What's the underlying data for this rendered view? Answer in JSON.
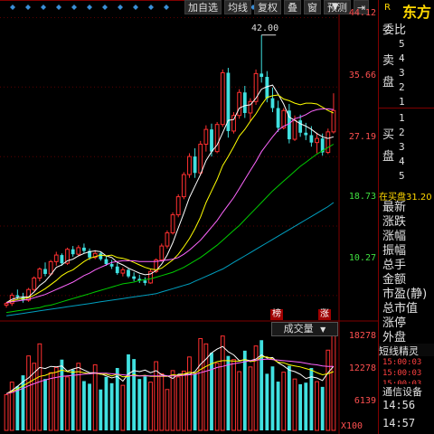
{
  "toolbar": {
    "buttons": [
      "加自选",
      "均线",
      "复权",
      "叠",
      "窗",
      "预测"
    ],
    "icon_dock": "pin-icon",
    "icon_menu": "triangle-down-icon"
  },
  "price_axis": [
    "44.12",
    "35.66",
    "27.19",
    "18.73",
    "10.27"
  ],
  "price_axis_values": [
    44.12,
    35.66,
    27.19,
    18.73,
    10.27
  ],
  "volume_axis": [
    "18278",
    "12278",
    "6139"
  ],
  "volume_unit": "X100",
  "high_marker": "42.00",
  "volume_panel": {
    "title": "成交量"
  },
  "badges": [
    "榜",
    "涨"
  ],
  "right_panel": {
    "stock_name": "东方",
    "r_label": "R",
    "weibi": "委比",
    "sell_label": "卖\n盘",
    "sell_levels": [
      "5",
      "4",
      "3",
      "2",
      "1"
    ],
    "buy_levels": [
      "1",
      "2",
      "3",
      "4",
      "5"
    ],
    "buy_label": "买\n盘",
    "buy_vol_text": "在买盘31.20",
    "fields": [
      "最新",
      "涨跌",
      "涨幅",
      "振幅",
      "总手",
      "金额",
      "市盈(静)",
      "总市值",
      "涨停",
      "外盘"
    ],
    "sl_title": "短线精灵",
    "sl_times": [
      "15:00:03",
      "15:00:03",
      "15:00:03"
    ],
    "comm": "通信设备",
    "clocks": [
      "14:56",
      "14:57"
    ]
  },
  "colors": {
    "up": "#ff3030",
    "down": "#40e0e0",
    "ma5": "#ffffff",
    "ma10": "#ffff00",
    "ma20": "#ff66ff",
    "ma60": "#00cc00",
    "ma120": "#00a0c0",
    "axis_red": "#800000"
  },
  "chart_data": {
    "type": "candlestick",
    "ylim": [
      7.5,
      44.5
    ],
    "candles": [
      [
        9.1,
        9.5,
        8.8,
        9.3
      ],
      [
        9.3,
        10.6,
        9.0,
        10.3
      ],
      [
        10.3,
        11.0,
        9.8,
        10.1
      ],
      [
        10.1,
        10.6,
        9.4,
        9.7
      ],
      [
        9.7,
        11.2,
        9.5,
        11.0
      ],
      [
        11.0,
        12.6,
        10.8,
        12.4
      ],
      [
        12.4,
        13.7,
        12.0,
        13.5
      ],
      [
        13.5,
        14.3,
        12.6,
        12.9
      ],
      [
        12.9,
        14.6,
        12.7,
        14.4
      ],
      [
        14.4,
        15.6,
        13.9,
        15.2
      ],
      [
        15.2,
        15.4,
        13.9,
        14.2
      ],
      [
        14.2,
        16.1,
        14.0,
        15.9
      ],
      [
        15.9,
        16.3,
        15.0,
        15.3
      ],
      [
        15.3,
        16.4,
        15.1,
        16.1
      ],
      [
        16.1,
        16.6,
        15.4,
        15.7
      ],
      [
        15.7,
        16.0,
        14.6,
        14.9
      ],
      [
        14.9,
        15.8,
        14.7,
        15.4
      ],
      [
        15.4,
        15.6,
        14.5,
        14.7
      ],
      [
        14.7,
        15.1,
        13.9,
        14.1
      ],
      [
        14.1,
        14.6,
        13.5,
        13.8
      ],
      [
        13.8,
        14.2,
        12.8,
        13.0
      ],
      [
        13.0,
        13.7,
        12.6,
        13.4
      ],
      [
        13.4,
        13.6,
        12.4,
        12.6
      ],
      [
        12.6,
        13.1,
        12.0,
        12.3
      ],
      [
        12.3,
        12.8,
        11.8,
        12.1
      ],
      [
        12.1,
        12.5,
        11.5,
        11.8
      ],
      [
        11.8,
        13.5,
        11.7,
        13.2
      ],
      [
        13.2,
        14.8,
        13.0,
        14.6
      ],
      [
        14.6,
        16.6,
        14.4,
        16.3
      ],
      [
        16.3,
        18.2,
        16.0,
        17.9
      ],
      [
        17.9,
        20.4,
        17.7,
        20.1
      ],
      [
        20.1,
        22.6,
        19.8,
        22.3
      ],
      [
        22.3,
        25.3,
        22.0,
        25.0
      ],
      [
        25.0,
        27.6,
        24.6,
        27.2
      ],
      [
        27.2,
        28.2,
        24.6,
        25.2
      ],
      [
        25.2,
        29.1,
        24.9,
        28.7
      ],
      [
        28.7,
        31.0,
        27.8,
        30.5
      ],
      [
        30.5,
        31.2,
        27.2,
        27.8
      ],
      [
        27.8,
        31.4,
        27.6,
        31.1
      ],
      [
        31.1,
        37.8,
        30.8,
        37.4
      ],
      [
        37.4,
        38.0,
        29.5,
        30.3
      ],
      [
        30.3,
        32.6,
        30.0,
        32.2
      ],
      [
        32.2,
        35.4,
        31.8,
        35.0
      ],
      [
        35.0,
        35.8,
        31.9,
        32.5
      ],
      [
        32.5,
        34.3,
        31.5,
        33.9
      ],
      [
        33.9,
        37.8,
        33.5,
        37.3
      ],
      [
        37.3,
        42.0,
        36.2,
        36.9
      ],
      [
        36.9,
        37.6,
        33.8,
        34.3
      ],
      [
        34.3,
        35.6,
        32.6,
        33.1
      ],
      [
        33.1,
        34.0,
        30.2,
        30.7
      ],
      [
        30.7,
        33.1,
        30.5,
        32.8
      ],
      [
        32.8,
        33.6,
        28.8,
        29.3
      ],
      [
        29.3,
        32.2,
        29.1,
        31.6
      ],
      [
        31.6,
        32.3,
        29.6,
        30.1
      ],
      [
        30.1,
        31.3,
        29.2,
        29.8
      ],
      [
        29.8,
        30.9,
        28.4,
        28.9
      ],
      [
        28.9,
        30.1,
        27.6,
        29.4
      ],
      [
        29.4,
        30.0,
        27.3,
        27.7
      ],
      [
        27.7,
        30.6,
        27.5,
        30.2
      ],
      [
        30.2,
        34.9,
        30.0,
        32.8
      ]
    ],
    "ma": {
      "ma5": [
        9.4,
        9.8,
        10.0,
        10.1,
        10.1,
        10.7,
        11.5,
        12.0,
        12.8,
        13.7,
        14.0,
        14.5,
        14.7,
        15.1,
        15.4,
        15.6,
        15.7,
        15.6,
        15.1,
        14.9,
        14.3,
        14.0,
        13.6,
        13.3,
        13.0,
        12.8,
        12.9,
        13.3,
        14.1,
        15.2,
        16.7,
        18.5,
        20.3,
        22.2,
        23.6,
        25.0,
        26.7,
        27.8,
        28.6,
        30.1,
        31.6,
        31.7,
        33.1,
        33.4,
        33.5,
        34.3,
        35.4,
        35.7,
        35.9,
        34.8,
        33.6,
        32.0,
        31.6,
        31.2,
        30.9,
        30.5,
        30.0,
        29.6,
        29.4,
        29.6
      ],
      "ma10": [
        9.4,
        9.6,
        9.8,
        9.9,
        10.0,
        10.3,
        10.7,
        11.1,
        11.6,
        12.1,
        12.7,
        13.1,
        13.4,
        13.9,
        14.4,
        14.8,
        15.0,
        15.2,
        15.1,
        15.2,
        14.9,
        14.8,
        14.6,
        14.3,
        14.0,
        13.7,
        13.5,
        13.4,
        13.6,
        14.1,
        14.6,
        15.3,
        16.2,
        17.2,
        18.4,
        19.8,
        21.6,
        23.0,
        24.4,
        26.1,
        27.2,
        28.4,
        29.7,
        30.5,
        31.5,
        32.4,
        33.5,
        34.4,
        34.6,
        34.7,
        34.2,
        34.0,
        33.7,
        33.5,
        33.7,
        33.7,
        33.6,
        33.2,
        32.8,
        32.5
      ],
      "ma20": [
        9.4,
        9.5,
        9.6,
        9.7,
        9.8,
        10.0,
        10.2,
        10.4,
        10.7,
        11.0,
        11.3,
        11.6,
        11.9,
        12.3,
        12.7,
        13.0,
        13.4,
        13.7,
        14.0,
        14.3,
        14.4,
        14.5,
        14.5,
        14.5,
        14.4,
        14.4,
        14.4,
        14.4,
        14.5,
        14.6,
        14.7,
        14.9,
        15.3,
        15.8,
        16.4,
        17.0,
        17.8,
        18.6,
        19.4,
        20.4,
        21.3,
        22.2,
        23.3,
        24.4,
        25.5,
        26.6,
        27.8,
        28.7,
        29.6,
        30.4,
        30.9,
        31.2,
        31.8,
        32.0,
        32.3,
        32.7,
        32.9,
        33.0,
        33.0,
        32.9
      ],
      "ma60": [
        8.2,
        8.3,
        8.4,
        8.5,
        8.6,
        8.7,
        8.8,
        9.0,
        9.1,
        9.3,
        9.5,
        9.7,
        9.9,
        10.1,
        10.3,
        10.5,
        10.7,
        10.9,
        11.1,
        11.3,
        11.5,
        11.7,
        11.8,
        11.9,
        12.1,
        12.2,
        12.3,
        12.5,
        12.7,
        12.9,
        13.1,
        13.4,
        13.7,
        14.1,
        14.5,
        14.9,
        15.4,
        15.9,
        16.4,
        17.0,
        17.6,
        18.2,
        18.8,
        19.5,
        20.2,
        20.9,
        21.6,
        22.3,
        23.0,
        23.6,
        24.2,
        24.8,
        25.4,
        26.0,
        26.5,
        27.0,
        27.5,
        27.9,
        28.3,
        28.7
      ],
      "ma120": [
        7.8,
        7.9,
        8.0,
        8.1,
        8.2,
        8.3,
        8.4,
        8.5,
        8.6,
        8.7,
        8.8,
        8.9,
        9.0,
        9.1,
        9.2,
        9.3,
        9.4,
        9.5,
        9.6,
        9.7,
        9.8,
        9.9,
        10.0,
        10.1,
        10.2,
        10.3,
        10.4,
        10.5,
        10.7,
        10.9,
        11.1,
        11.3,
        11.5,
        11.7,
        12.0,
        12.3,
        12.6,
        12.9,
        13.2,
        13.5,
        13.9,
        14.3,
        14.7,
        15.1,
        15.5,
        15.9,
        16.3,
        16.7,
        17.1,
        17.5,
        17.9,
        18.3,
        18.7,
        19.1,
        19.5,
        19.9,
        20.3,
        20.7,
        21.1,
        21.6
      ]
    },
    "volume": {
      "ylim": [
        0,
        18278
      ],
      "values": [
        6800,
        9200,
        8400,
        10500,
        14200,
        12800,
        16500,
        9800,
        11000,
        12000,
        13500,
        10200,
        11600,
        12800,
        9400,
        8900,
        12500,
        7800,
        10200,
        9000,
        11900,
        8600,
        14500,
        13600,
        9800,
        10300,
        9200,
        13100,
        10800,
        7800,
        11400,
        10200,
        11300,
        14000,
        10800,
        17500,
        16500,
        14800,
        12800,
        18000,
        14200,
        13500,
        11200,
        15200,
        12100,
        16100,
        17200,
        10800,
        12200,
        9300,
        11100,
        12300,
        9800,
        8800,
        9100,
        11900,
        9300,
        8300,
        15300,
        18200
      ],
      "ma5": [
        7000,
        7600,
        8400,
        9300,
        10000,
        11000,
        12000,
        11800,
        12200,
        12100,
        12300,
        11300,
        11700,
        12000,
        11500,
        11000,
        11000,
        10800,
        10400,
        10000,
        10300,
        9400,
        10800,
        11400,
        11200,
        11500,
        11000,
        11400,
        10600,
        10400,
        9900,
        10700,
        10700,
        10700,
        11200,
        12600,
        13600,
        14800,
        15500,
        16000,
        15000,
        14400,
        13300,
        13500,
        13300,
        13600,
        14400,
        13800,
        13900,
        12900,
        12300,
        11500,
        11200,
        10700,
        9900,
        10200,
        10000,
        9500,
        11000,
        12200
      ],
      "ma10": [
        7000,
        7400,
        7900,
        8500,
        9100,
        9700,
        10300,
        10500,
        10900,
        11100,
        11500,
        11200,
        11100,
        11200,
        11000,
        10800,
        10900,
        10700,
        10700,
        10400,
        10700,
        10200,
        10300,
        10600,
        10400,
        10500,
        10300,
        10300,
        10300,
        10300,
        10600,
        10500,
        10700,
        11100,
        10900,
        11600,
        12200,
        12700,
        13100,
        13300,
        13300,
        13200,
        13200,
        13500,
        13100,
        13300,
        14000,
        14000,
        13600,
        13000,
        12900,
        12500,
        12300,
        12100,
        11800,
        11500,
        11000,
        10600,
        10800,
        11200
      ],
      "ma20": [
        7000,
        7200,
        7600,
        8000,
        8500,
        8900,
        9300,
        9600,
        9900,
        10100,
        10300,
        10400,
        10500,
        10600,
        10700,
        10800,
        10900,
        10900,
        10900,
        10800,
        10700,
        10600,
        10500,
        10400,
        10400,
        10400,
        10400,
        10400,
        10400,
        10400,
        10400,
        10400,
        10500,
        10600,
        10700,
        11000,
        11300,
        11600,
        12000,
        12200,
        12500,
        12700,
        12900,
        13100,
        13300,
        13400,
        13500,
        13600,
        13500,
        13400,
        13300,
        13200,
        13100,
        13000,
        12800,
        12600,
        12500,
        12300,
        12200,
        12200
      ]
    }
  }
}
